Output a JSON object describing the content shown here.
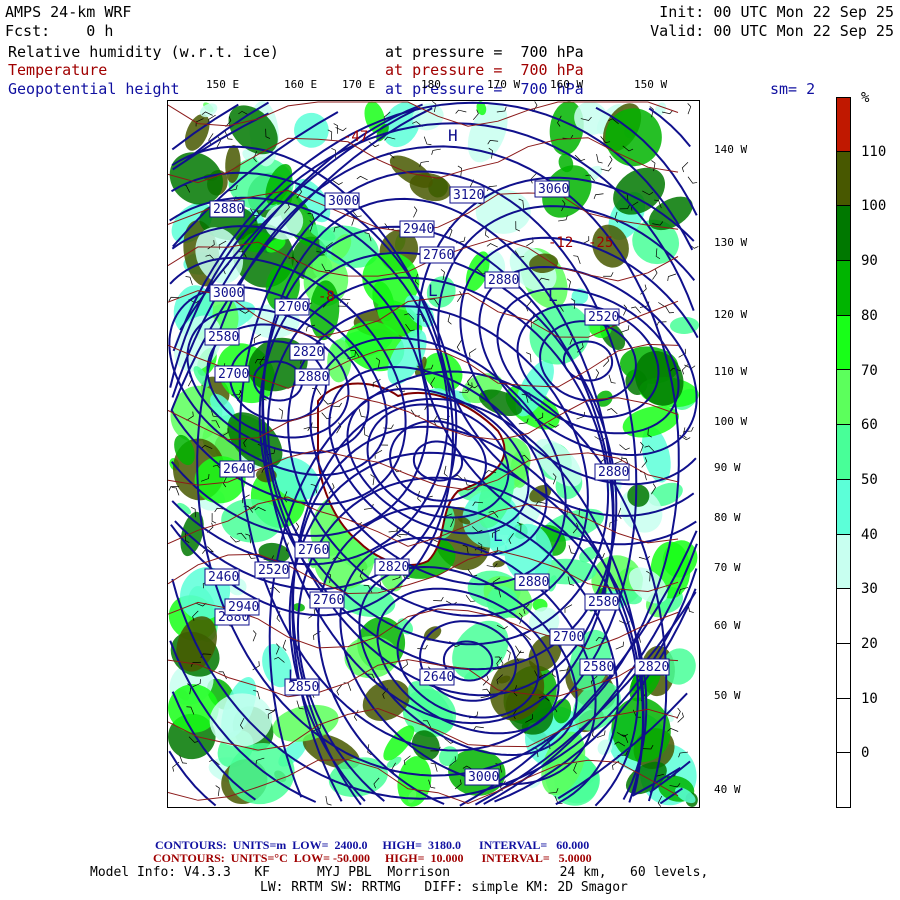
{
  "header": {
    "model": "AMPS 24-km WRF",
    "fcst": "Fcst:    0 h",
    "init": "Init: 00 UTC Mon 22 Sep 25",
    "valid": "Valid: 00 UTC Mon 22 Sep 25",
    "field1": "Relative humidity (w.r.t. ice)",
    "field1_level": "at pressure =  700 hPa",
    "field2": "Temperature",
    "field2_level": "at pressure =  700 hPa",
    "field3": "Geopotential height",
    "field3_level": "at pressure =  700 hPa",
    "smoothing": "sm= 2"
  },
  "map": {
    "top_labels": [
      "150 E",
      "160 E",
      "170 E",
      "180",
      "170 W",
      "160 W",
      "150 W"
    ],
    "right_labels": [
      "140 W",
      "130 W",
      "120 W",
      "110 W",
      "100 W",
      "90 W",
      "80 W",
      "70 W",
      "60 W",
      "50 W",
      "40 W"
    ],
    "height_labels": [
      "2880",
      "3000",
      "2940",
      "3120",
      "3060",
      "2760",
      "2880",
      "3000",
      "2700",
      "2640",
      "2580",
      "2820",
      "2760",
      "2520",
      "2580",
      "2460",
      "2820",
      "2700",
      "2880",
      "2760",
      "2880",
      "2850",
      "2640",
      "2580",
      "2880",
      "2820",
      "3000",
      "2940",
      "2700",
      "2880",
      "2520"
    ],
    "temp_labels": [
      "-47",
      "-12",
      "-25",
      "-8"
    ],
    "highs_lows": [
      "H",
      "L",
      "L",
      "L",
      "L"
    ]
  },
  "colorbar": {
    "unit": "%",
    "labels": [
      "110",
      "100",
      "90",
      "80",
      "70",
      "60",
      "50",
      "40",
      "30",
      "20",
      "10",
      "0"
    ],
    "colors": [
      "#c01800",
      "#485800",
      "#007800",
      "#00b400",
      "#18ff18",
      "#5cff5c",
      "#48ff98",
      "#5cffd8",
      "#c8fff0",
      "#ffffff",
      "#ffffff",
      "#ffffff",
      "#ffffff"
    ]
  },
  "footer": {
    "c1": "CONTOURS:  UNITS=m  LOW=  2400.0     HIGH=  3180.0      INTERVAL=   60.000",
    "c2": "CONTOURS:  UNITS=°C  LOW= -50.000     HIGH=  10.000      INTERVAL=   5.0000",
    "info1": "Model Info: V4.3.3   KF      MYJ PBL  Morrison              24 km,   60 levels,",
    "info2": "LW: RRTM SW: RRTMG   DIFF: simple KM: 2D Smagor"
  }
}
